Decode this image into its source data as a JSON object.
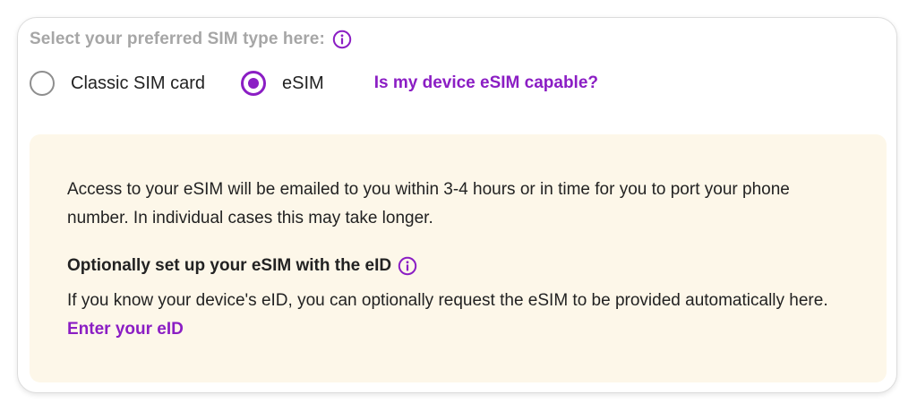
{
  "sim_type": {
    "prompt": "Select your preferred SIM type here:",
    "info_icon": "info-icon",
    "options": [
      {
        "label": "Classic SIM card",
        "selected": false
      },
      {
        "label": "eSIM",
        "selected": true
      }
    ],
    "capable_link": "Is my device eSIM capable?"
  },
  "notice": {
    "text": "Access to your eSIM will be emailed to you within 3-4 hours or in time for you to port your phone number. In individual cases this may take longer.",
    "eid_heading": "Optionally set up your eSIM with the eID",
    "eid_info_icon": "info-icon",
    "eid_text": "If you know your device's eID, you can optionally request the eSIM to be provided automatically here.",
    "eid_link": "Enter your eID"
  },
  "colors": {
    "accent": "#8b1ec4",
    "notice_background": "#fdf7e9",
    "prompt_text": "#a6a6a6",
    "body_text": "#222222"
  }
}
